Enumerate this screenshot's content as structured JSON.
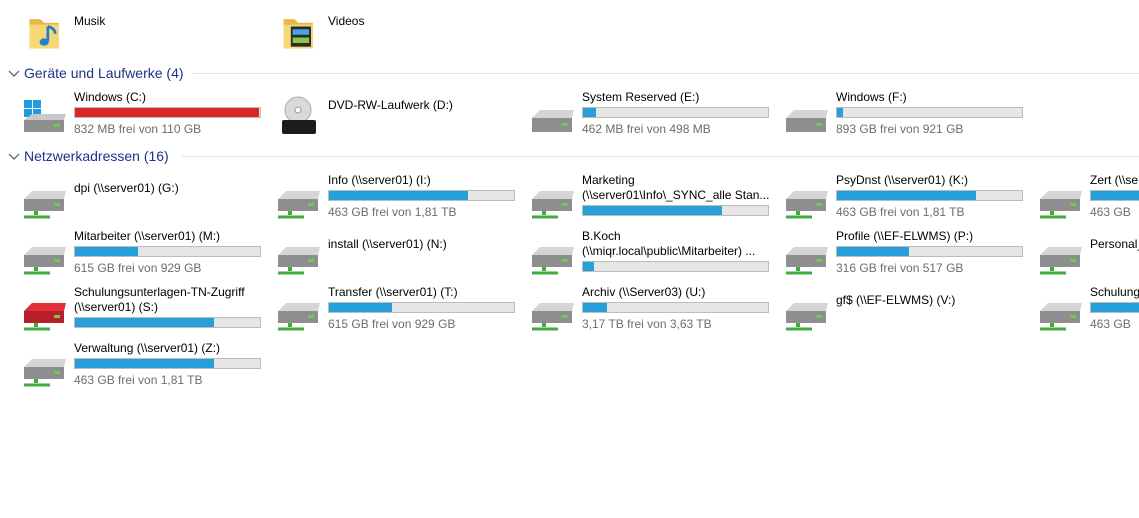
{
  "folders": [
    {
      "name": "Musik",
      "icon": "music-folder-icon"
    },
    {
      "name": "Videos",
      "icon": "video-folder-icon"
    }
  ],
  "groups": {
    "devices": {
      "label": "Geräte und Laufwerke (4)"
    },
    "network": {
      "label": "Netzwerkadressen (16)"
    }
  },
  "devices": [
    {
      "name": "Windows (C:)",
      "free": "832 MB frei von 110 GB",
      "used_fraction": 0.993,
      "icon": "windows-drive-icon",
      "status_color": "#da2626"
    },
    {
      "name": "DVD-RW-Laufwerk (D:)",
      "icon": "dvd-drive-icon"
    },
    {
      "name": "System Reserved (E:)",
      "free": "462 MB frei von 498 MB",
      "used_fraction": 0.07,
      "icon": "hard-drive-icon"
    },
    {
      "name": "Windows (F:)",
      "free": "893 GB frei von 921 GB",
      "used_fraction": 0.03,
      "icon": "hard-drive-icon"
    }
  ],
  "network": [
    {
      "name": "dpi (\\\\server01) (G:)"
    },
    {
      "name": "Info (\\\\server01) (I:)",
      "free": "463 GB frei von 1,81 TB",
      "used_fraction": 0.75
    },
    {
      "name": "Marketing",
      "name2": "(\\\\server01\\Info\\_SYNC_alle Stan...",
      "used_fraction": 0.75
    },
    {
      "name": "PsyDnst (\\\\server01) (K:)",
      "free": "463 GB frei von 1,81 TB",
      "used_fraction": 0.75
    },
    {
      "name": "Zert (\\\\se",
      "free": "463 GB",
      "used_fraction": 0.75
    },
    {
      "name": "Mitarbeiter (\\\\server01) (M:)",
      "free": "615 GB frei von 929 GB",
      "used_fraction": 0.34
    },
    {
      "name": "install (\\\\server01) (N:)"
    },
    {
      "name": "B.Koch",
      "name2": "(\\\\miqr.local\\public\\Mitarbeiter) ...",
      "used_fraction": 0.06
    },
    {
      "name": "Profile (\\\\EF-ELWMS) (P:)",
      "free": "316 GB frei von 517 GB",
      "used_fraction": 0.39
    },
    {
      "name": "Personal_"
    },
    {
      "name": "Schulungsunterlagen-TN-Zugriff",
      "name2": "(\\\\server01) (S:)",
      "used_fraction": 0.75,
      "icon": "red-network-drive-icon"
    },
    {
      "name": "Transfer (\\\\server01) (T:)",
      "free": "615 GB frei von 929 GB",
      "used_fraction": 0.34
    },
    {
      "name": "Archiv (\\\\Server03) (U:)",
      "free": "3,17 TB frei von 3,63 TB",
      "used_fraction": 0.13
    },
    {
      "name": "gf$ (\\\\EF-ELWMS) (V:)"
    },
    {
      "name": "Schulung",
      "free": "463 GB",
      "used_fraction": 0.75
    },
    {
      "name": "Verwaltung (\\\\server01) (Z:)",
      "free": "463 GB frei von 1,81 TB",
      "used_fraction": 0.75
    }
  ],
  "colors": {
    "bar_fill": "#26a0da",
    "bar_full": "#da2626",
    "group_label": "#1e3287"
  }
}
